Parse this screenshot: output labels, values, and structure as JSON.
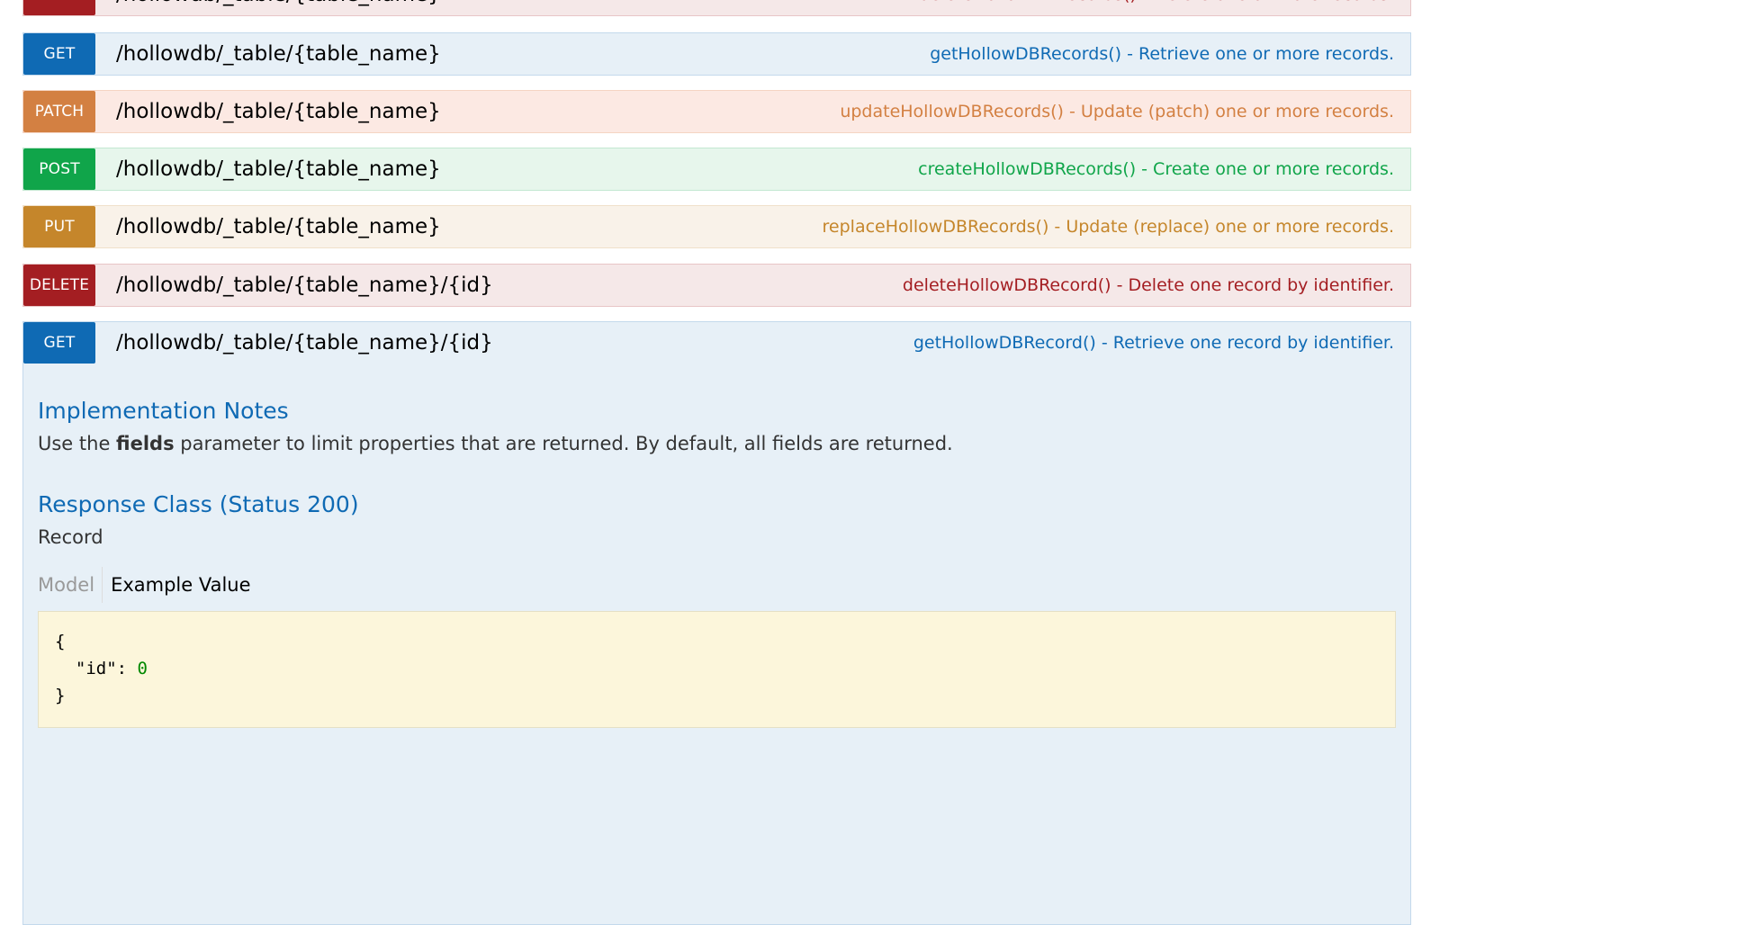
{
  "operations": [
    {
      "method": "DELETE",
      "path": "/hollowdb/_table/{table_name}",
      "summary": "deleteHollowDBRecords() - Delete one or more records."
    },
    {
      "method": "GET",
      "path": "/hollowdb/_table/{table_name}",
      "summary": "getHollowDBRecords() - Retrieve one or more records."
    },
    {
      "method": "PATCH",
      "path": "/hollowdb/_table/{table_name}",
      "summary": "updateHollowDBRecords() - Update (patch) one or more records."
    },
    {
      "method": "POST",
      "path": "/hollowdb/_table/{table_name}",
      "summary": "createHollowDBRecords() - Create one or more records."
    },
    {
      "method": "PUT",
      "path": "/hollowdb/_table/{table_name}",
      "summary": "replaceHollowDBRecords() - Update (replace) one or more records."
    },
    {
      "method": "DELETE",
      "path": "/hollowdb/_table/{table_name}/{id}",
      "summary": "deleteHollowDBRecord() - Delete one record by identifier."
    },
    {
      "method": "GET",
      "path": "/hollowdb/_table/{table_name}/{id}",
      "summary": "getHollowDBRecord() - Retrieve one record by identifier."
    }
  ],
  "expanded": {
    "notes_heading": "Implementation Notes",
    "notes_prefix": "Use the ",
    "notes_bold": "fields",
    "notes_suffix": " parameter to limit properties that are returned. By default, all fields are returned.",
    "response_heading": "Response Class (Status 200)",
    "response_class": "Record",
    "tab_model": "Model",
    "tab_example": "Example Value",
    "code_open": "{",
    "code_key": "  \"id\": ",
    "code_value": "0",
    "code_close": "}"
  },
  "colors": {
    "get": "#0f6ab4",
    "patch": "#d38042",
    "post": "#10a54a",
    "put": "#c5862b",
    "delete": "#a41e22"
  }
}
